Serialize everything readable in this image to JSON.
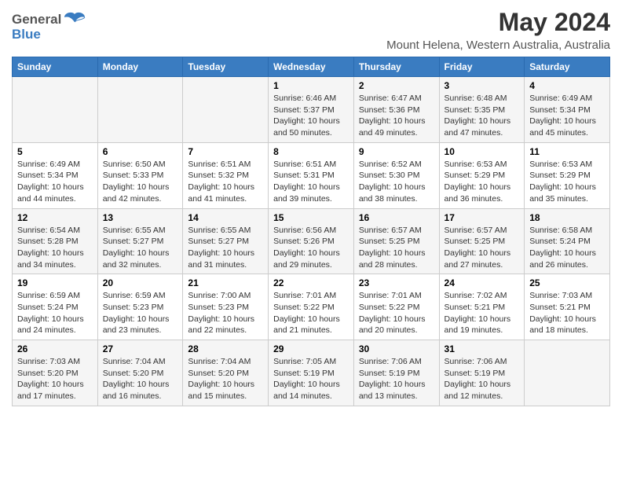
{
  "logo": {
    "line1": "General",
    "line2": "Blue"
  },
  "title": "May 2024",
  "subtitle": "Mount Helena, Western Australia, Australia",
  "days_of_week": [
    "Sunday",
    "Monday",
    "Tuesday",
    "Wednesday",
    "Thursday",
    "Friday",
    "Saturday"
  ],
  "weeks": [
    [
      {
        "day": "",
        "info": ""
      },
      {
        "day": "",
        "info": ""
      },
      {
        "day": "",
        "info": ""
      },
      {
        "day": "1",
        "info": "Sunrise: 6:46 AM\nSunset: 5:37 PM\nDaylight: 10 hours and 50 minutes."
      },
      {
        "day": "2",
        "info": "Sunrise: 6:47 AM\nSunset: 5:36 PM\nDaylight: 10 hours and 49 minutes."
      },
      {
        "day": "3",
        "info": "Sunrise: 6:48 AM\nSunset: 5:35 PM\nDaylight: 10 hours and 47 minutes."
      },
      {
        "day": "4",
        "info": "Sunrise: 6:49 AM\nSunset: 5:34 PM\nDaylight: 10 hours and 45 minutes."
      }
    ],
    [
      {
        "day": "5",
        "info": "Sunrise: 6:49 AM\nSunset: 5:34 PM\nDaylight: 10 hours and 44 minutes."
      },
      {
        "day": "6",
        "info": "Sunrise: 6:50 AM\nSunset: 5:33 PM\nDaylight: 10 hours and 42 minutes."
      },
      {
        "day": "7",
        "info": "Sunrise: 6:51 AM\nSunset: 5:32 PM\nDaylight: 10 hours and 41 minutes."
      },
      {
        "day": "8",
        "info": "Sunrise: 6:51 AM\nSunset: 5:31 PM\nDaylight: 10 hours and 39 minutes."
      },
      {
        "day": "9",
        "info": "Sunrise: 6:52 AM\nSunset: 5:30 PM\nDaylight: 10 hours and 38 minutes."
      },
      {
        "day": "10",
        "info": "Sunrise: 6:53 AM\nSunset: 5:29 PM\nDaylight: 10 hours and 36 minutes."
      },
      {
        "day": "11",
        "info": "Sunrise: 6:53 AM\nSunset: 5:29 PM\nDaylight: 10 hours and 35 minutes."
      }
    ],
    [
      {
        "day": "12",
        "info": "Sunrise: 6:54 AM\nSunset: 5:28 PM\nDaylight: 10 hours and 34 minutes."
      },
      {
        "day": "13",
        "info": "Sunrise: 6:55 AM\nSunset: 5:27 PM\nDaylight: 10 hours and 32 minutes."
      },
      {
        "day": "14",
        "info": "Sunrise: 6:55 AM\nSunset: 5:27 PM\nDaylight: 10 hours and 31 minutes."
      },
      {
        "day": "15",
        "info": "Sunrise: 6:56 AM\nSunset: 5:26 PM\nDaylight: 10 hours and 29 minutes."
      },
      {
        "day": "16",
        "info": "Sunrise: 6:57 AM\nSunset: 5:25 PM\nDaylight: 10 hours and 28 minutes."
      },
      {
        "day": "17",
        "info": "Sunrise: 6:57 AM\nSunset: 5:25 PM\nDaylight: 10 hours and 27 minutes."
      },
      {
        "day": "18",
        "info": "Sunrise: 6:58 AM\nSunset: 5:24 PM\nDaylight: 10 hours and 26 minutes."
      }
    ],
    [
      {
        "day": "19",
        "info": "Sunrise: 6:59 AM\nSunset: 5:24 PM\nDaylight: 10 hours and 24 minutes."
      },
      {
        "day": "20",
        "info": "Sunrise: 6:59 AM\nSunset: 5:23 PM\nDaylight: 10 hours and 23 minutes."
      },
      {
        "day": "21",
        "info": "Sunrise: 7:00 AM\nSunset: 5:23 PM\nDaylight: 10 hours and 22 minutes."
      },
      {
        "day": "22",
        "info": "Sunrise: 7:01 AM\nSunset: 5:22 PM\nDaylight: 10 hours and 21 minutes."
      },
      {
        "day": "23",
        "info": "Sunrise: 7:01 AM\nSunset: 5:22 PM\nDaylight: 10 hours and 20 minutes."
      },
      {
        "day": "24",
        "info": "Sunrise: 7:02 AM\nSunset: 5:21 PM\nDaylight: 10 hours and 19 minutes."
      },
      {
        "day": "25",
        "info": "Sunrise: 7:03 AM\nSunset: 5:21 PM\nDaylight: 10 hours and 18 minutes."
      }
    ],
    [
      {
        "day": "26",
        "info": "Sunrise: 7:03 AM\nSunset: 5:20 PM\nDaylight: 10 hours and 17 minutes."
      },
      {
        "day": "27",
        "info": "Sunrise: 7:04 AM\nSunset: 5:20 PM\nDaylight: 10 hours and 16 minutes."
      },
      {
        "day": "28",
        "info": "Sunrise: 7:04 AM\nSunset: 5:20 PM\nDaylight: 10 hours and 15 minutes."
      },
      {
        "day": "29",
        "info": "Sunrise: 7:05 AM\nSunset: 5:19 PM\nDaylight: 10 hours and 14 minutes."
      },
      {
        "day": "30",
        "info": "Sunrise: 7:06 AM\nSunset: 5:19 PM\nDaylight: 10 hours and 13 minutes."
      },
      {
        "day": "31",
        "info": "Sunrise: 7:06 AM\nSunset: 5:19 PM\nDaylight: 10 hours and 12 minutes."
      },
      {
        "day": "",
        "info": ""
      }
    ]
  ]
}
